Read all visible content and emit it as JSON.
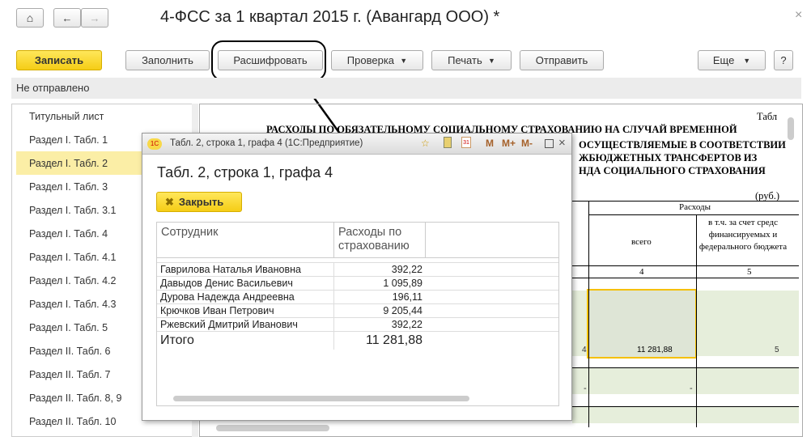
{
  "header": {
    "title": "4-ФСС за 1 квартал 2015 г. (Авангард ООО) *",
    "close": "×"
  },
  "toolbar": {
    "save": "Записать",
    "fill": "Заполнить",
    "decode": "Расшифровать",
    "check": "Проверка",
    "print": "Печать",
    "send": "Отправить",
    "more": "Еще",
    "help": "?"
  },
  "status": "Не отправлено",
  "sidebar": {
    "items": [
      {
        "label": "Титульный лист"
      },
      {
        "label": "Раздел I. Табл. 1"
      },
      {
        "label": "Раздел I. Табл. 2"
      },
      {
        "label": "Раздел I. Табл. 3"
      },
      {
        "label": "Раздел I. Табл. 3.1"
      },
      {
        "label": "Раздел I. Табл. 4"
      },
      {
        "label": "Раздел I. Табл. 4.1"
      },
      {
        "label": "Раздел I. Табл. 4.2"
      },
      {
        "label": "Раздел I. Табл. 4.3"
      },
      {
        "label": "Раздел I. Табл. 5"
      },
      {
        "label": "Раздел II. Табл. 6"
      },
      {
        "label": "Раздел II. Табл. 7"
      },
      {
        "label": "Раздел II. Табл. 8, 9"
      },
      {
        "label": "Раздел II. Табл. 10"
      }
    ],
    "selected": 2
  },
  "report": {
    "table_label": "Табл",
    "title_lines": [
      "РАСХОДЫ ПО ОБЯЗАТЕЛЬНОМУ СОЦИАЛЬНОМУ СТРАХОВАНИЮ НА СЛУЧАЙ ВРЕМЕННОЙ",
      "ОСУЩЕСТВЛЯЕМЫЕ В СООТВЕТСТВИИ",
      "ЖБЮДЖЕТНЫХ ТРАНСФЕРТОВ ИЗ",
      "НДА СОЦИАЛЬНОГО СТРАХОВАНИЯ"
    ],
    "unit": "(руб.)",
    "col_group": "Расходы",
    "col_total": "всего",
    "col_fed": "в т.ч. за счет средс финансируемых и федерального бюджета",
    "col_num4": "4",
    "col_num5": "5",
    "row_num": "4",
    "value": "11 281,88",
    "value5": "5",
    "dash": "-"
  },
  "popup": {
    "window_title": "Табл. 2, строка 1, графа 4  (1С:Предприятие)",
    "heading": "Табл. 2, строка 1, графа 4",
    "close_btn": "Закрыть",
    "col_employee": "Сотрудник",
    "col_expense": "Расходы по страхованию",
    "rows": [
      {
        "name": "Гаврилова Наталья Ивановна",
        "value": "392,22"
      },
      {
        "name": "Давыдов Денис Васильевич",
        "value": "1 095,89"
      },
      {
        "name": "Дурова Надежда Андреевна",
        "value": "196,11"
      },
      {
        "name": "Крючков Иван Петрович",
        "value": "9 205,44"
      },
      {
        "name": "Ржевский Дмитрий Иванович",
        "value": "392,22"
      }
    ],
    "total_label": "Итого",
    "total_value": "11 281,88",
    "m": "M",
    "mplus": "M+",
    "mminus": "M-"
  }
}
